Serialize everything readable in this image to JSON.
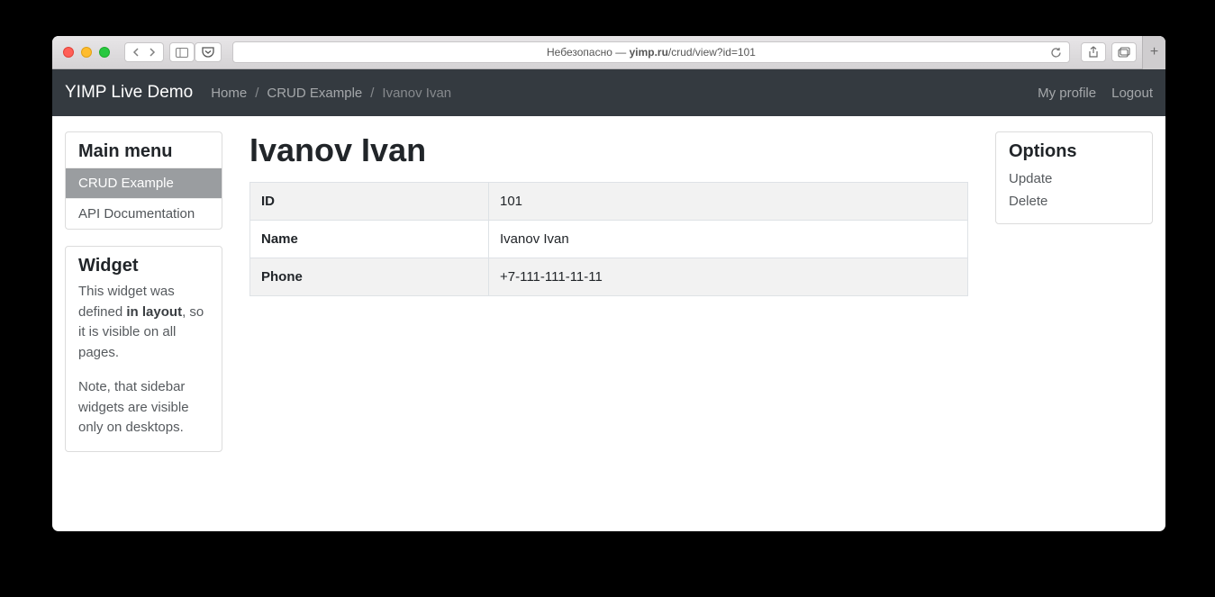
{
  "browser": {
    "url_prefix": "Небезопасно — ",
    "url_domain": "yimp.ru",
    "url_path": "/crud/view?id=101"
  },
  "navbar": {
    "brand": "YIMP Live Demo",
    "breadcrumbs": {
      "home": "Home",
      "crud": "CRUD Example",
      "current": "Ivanov Ivan"
    },
    "right": {
      "profile": "My profile",
      "logout": "Logout"
    }
  },
  "sidebar": {
    "menu_title": "Main menu",
    "items": [
      {
        "label": "CRUD Example",
        "active": true
      },
      {
        "label": "API Documentation",
        "active": false
      }
    ],
    "widget_title": "Widget",
    "widget_p1_a": "This widget was defined ",
    "widget_p1_b": "in layout",
    "widget_p1_c": ", so it is visible on all pages.",
    "widget_p2": "Note, that sidebar widgets are visible only on desktops."
  },
  "main": {
    "title": "Ivanov Ivan",
    "rows": [
      {
        "label": "ID",
        "value": "101"
      },
      {
        "label": "Name",
        "value": "Ivanov Ivan"
      },
      {
        "label": "Phone",
        "value": "+7-111-111-11-11"
      }
    ]
  },
  "options": {
    "title": "Options",
    "items": [
      {
        "label": "Update"
      },
      {
        "label": "Delete"
      }
    ]
  }
}
